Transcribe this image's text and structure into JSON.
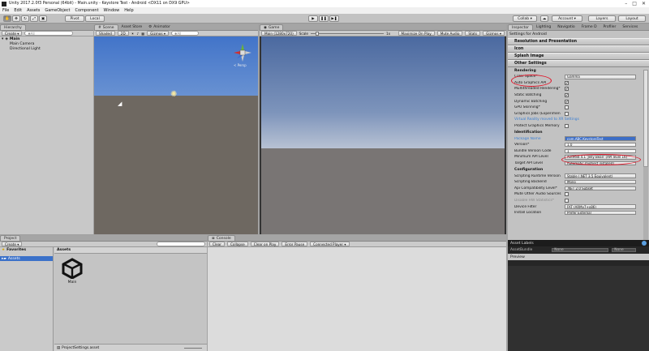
{
  "window": {
    "title": "Unity 2017.2.0f3 Personal (64bit) - Main.unity - Keystore Test - Android <DX11 on DX9 GPU>",
    "controls": [
      "–",
      "□",
      "✕"
    ]
  },
  "menu": [
    "File",
    "Edit",
    "Assets",
    "GameObject",
    "Component",
    "Window",
    "Help"
  ],
  "toolbar": {
    "pivot_label": "Pivot",
    "local_label": "Local",
    "play": "▶",
    "pause": "❚❚",
    "step": "▶❚",
    "collab": "Collab ▾",
    "account": "Account ▾",
    "layers": "Layers",
    "layout": "Layout"
  },
  "hierarchy": {
    "tab": "Hierarchy",
    "create": "Create ▾",
    "search": "✱All",
    "scene": "Main",
    "items": [
      "Main Camera",
      "Directional Light"
    ]
  },
  "scene_view": {
    "tabs": [
      "Scene",
      "Asset Store",
      "Animator"
    ],
    "shading": "Shaded",
    "mode_2d": "2D",
    "gizmos": "Gizmos ▾",
    "search": "✱All",
    "persp": "< Persp"
  },
  "game_view": {
    "tab": "Game",
    "display": "Main (1280x720)",
    "scale_label": "Scale",
    "scale_value": "1x",
    "buttons": [
      "Maximize On Play",
      "Mute Audio",
      "Stats",
      "Gizmos ▾"
    ]
  },
  "inspector": {
    "tabs": [
      "Inspector",
      "Lighting",
      "Navigatio",
      "Frame D",
      "Profiler",
      "Services"
    ],
    "title": "Settings for Android",
    "sections": [
      "Resolution and Presentation",
      "Icon",
      "Splash Image",
      "Other Settings"
    ],
    "rendering_header": "Rendering",
    "rendering": [
      {
        "label": "Color Space*",
        "type": "dropdown",
        "value": "Gamma"
      },
      {
        "label": "Auto Graphics API",
        "type": "check",
        "value": "✔"
      },
      {
        "label": "Multithreaded Rendering*",
        "type": "check",
        "value": "✔"
      },
      {
        "label": "Static Batching",
        "type": "check",
        "value": "✔"
      },
      {
        "label": "Dynamic Batching",
        "type": "check",
        "value": "✔"
      },
      {
        "label": "GPU Skinning*",
        "type": "check",
        "value": ""
      },
      {
        "label": "Graphics Jobs (Experimen",
        "type": "check",
        "value": ""
      },
      {
        "label": "Virtual Reality moved to XR Settings",
        "type": "link",
        "value": ""
      },
      {
        "label": "Protect Graphics Memory",
        "type": "check",
        "value": ""
      }
    ],
    "identification_header": "Identification",
    "identification": [
      {
        "label": "Package Name",
        "type": "field",
        "value": "com.ABC.KeystoreTest"
      },
      {
        "label": "Version*",
        "type": "field",
        "value": "1.0"
      },
      {
        "label": "Bundle Version Code",
        "type": "field",
        "value": "1"
      },
      {
        "label": "Minimum API Level",
        "type": "dropdown",
        "value": "Android 4.1 'Jelly Bean' (API level 16)"
      },
      {
        "label": "Target API Level",
        "type": "dropdown",
        "value": "Automatic (highest installed)"
      }
    ],
    "configuration_header": "Configuration",
    "configuration": [
      {
        "label": "Scripting Runtime Version",
        "type": "dropdown",
        "value": "Stable (.NET 3.5 Equivalent)"
      },
      {
        "label": "Scripting Backend",
        "type": "dropdown",
        "value": "Mono"
      },
      {
        "label": "Api Compatibility Level*",
        "type": "dropdown",
        "value": ".NET 2.0 Subset"
      },
      {
        "label": "Mute Other Audio Sources",
        "type": "check",
        "value": ""
      },
      {
        "label": "Disable HW Statistics*",
        "type": "check",
        "value": ""
      },
      {
        "label": "Device Filter",
        "type": "dropdown",
        "value": "FAT (ARMv7+x86)"
      },
      {
        "label": "Install Location",
        "type": "dropdown",
        "value": "Prefer External"
      }
    ]
  },
  "project": {
    "tab": "Project",
    "create": "Create ▾",
    "favorites": "Favorites",
    "assets_folder": "Assets",
    "assets_header": "Assets",
    "asset_name": "Main",
    "footer": "ProjectSettings.asset"
  },
  "console": {
    "tab": "Console",
    "buttons": [
      "Clear",
      "Collapse",
      "Clear on Play",
      "Error Pause",
      "Connected Player ▾"
    ]
  },
  "asset_labels": {
    "title": "Asset Labels",
    "assetbundle_label": "AssetBundle",
    "none1": "None",
    "none2": "None",
    "preview": "Preview"
  }
}
